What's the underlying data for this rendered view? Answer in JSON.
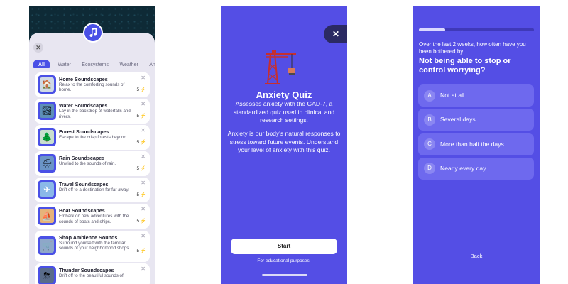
{
  "colors": {
    "primary": "#544ee5",
    "accent": "#4a50e6",
    "bolt": "#f2a11f"
  },
  "soundscapes": {
    "top_icon": "music-note-icon",
    "close_glyph": "✕",
    "tabs": [
      "All",
      "Water",
      "Ecosystems",
      "Weather",
      "Anim"
    ],
    "active_tab": "All",
    "items": [
      {
        "title": "Home Soundscapes",
        "desc": "Relax to the comforting sounds of home.",
        "count": "5",
        "icon": "house-icon",
        "emoji": "🏠",
        "close": "✕",
        "bolt": "⚡"
      },
      {
        "title": "Water Soundscapes",
        "desc": "Lay in the backdrop of waterfalls and rivers.",
        "count": "5",
        "icon": "waterfall-icon",
        "emoji": "🏞",
        "close": "✕",
        "bolt": "⚡"
      },
      {
        "title": "Forest Soundscapes",
        "desc": "Escape to the crisp forests beyond.",
        "count": "5",
        "icon": "tree-icon",
        "emoji": "🌲",
        "close": "✕",
        "bolt": "⚡"
      },
      {
        "title": "Rain Soundscapes",
        "desc": "Unwind to the sounds of rain.",
        "count": "5",
        "icon": "rain-cloud-icon",
        "emoji": "🌧",
        "close": "✕",
        "bolt": "⚡"
      },
      {
        "title": "Travel Soundscapes",
        "desc": "Drift off to a destination far far away.",
        "count": "5",
        "icon": "airplane-icon",
        "emoji": "✈",
        "close": "✕",
        "bolt": "⚡"
      },
      {
        "title": "Boat Soundscapes",
        "desc": "Embark on new adventures with the sounds of boats and ships.",
        "count": "5",
        "icon": "boat-icon",
        "emoji": "⛵",
        "close": "✕",
        "bolt": "⚡"
      },
      {
        "title": "Shop Ambience Sounds",
        "desc": "Surround yourself with the familiar sounds of your neighborhood shops.",
        "count": "5",
        "icon": "shopping-cart-icon",
        "emoji": "🛒",
        "close": "✕",
        "bolt": "⚡"
      },
      {
        "title": "Thunder Soundscapes",
        "desc": "Drift off to the beautiful sounds of",
        "count": "",
        "icon": "storm-cloud-icon",
        "emoji": "⛈",
        "close": "✕",
        "bolt": ""
      }
    ]
  },
  "quiz_intro": {
    "close_glyph": "✕",
    "illustration": "crane-icon",
    "title": "Anxiety Quiz",
    "description": "Assesses anxiety with the GAD-7, a standardized quiz used in clinical and research settings.",
    "description2": "Anxiety is our body's natural responses to stress toward future events. Understand your level of anxiety with this quiz.",
    "start_label": "Start",
    "note": "For educational purposes."
  },
  "quiz_question": {
    "progress": 0.23,
    "prompt": "Over the last 2 weeks, how often have you been bothered by...",
    "question": "Not being able to stop or control worrying?",
    "options": [
      {
        "letter": "A",
        "label": "Not at all"
      },
      {
        "letter": "B",
        "label": "Several days"
      },
      {
        "letter": "C",
        "label": "More than half the days"
      },
      {
        "letter": "D",
        "label": "Nearly every day"
      }
    ],
    "back_label": "Back"
  }
}
